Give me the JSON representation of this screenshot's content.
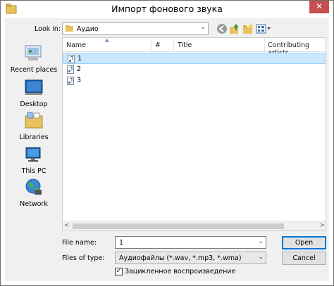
{
  "window": {
    "title": "Импорт фонового звука",
    "close_label": "✕"
  },
  "lookin": {
    "label": "Look in:",
    "value": "Аудио"
  },
  "toolbar": {
    "back": "back-icon",
    "up": "up-folder-icon",
    "new_folder": "new-folder-icon",
    "view": "view-menu-icon"
  },
  "places": [
    {
      "label": "Recent places",
      "icon": "recent-places-icon"
    },
    {
      "label": "Desktop",
      "icon": "desktop-icon"
    },
    {
      "label": "Libraries",
      "icon": "libraries-icon"
    },
    {
      "label": "This PC",
      "icon": "this-pc-icon"
    },
    {
      "label": "Network",
      "icon": "network-icon"
    }
  ],
  "columns": [
    {
      "label": "Name"
    },
    {
      "label": "#"
    },
    {
      "label": "Title"
    },
    {
      "label": "Contributing artists"
    }
  ],
  "files": [
    {
      "name": "1",
      "selected": true
    },
    {
      "name": "2",
      "selected": false
    },
    {
      "name": "3",
      "selected": false
    }
  ],
  "filename": {
    "label": "File name:",
    "value": "1"
  },
  "filetype": {
    "label": "Files of type:",
    "value": "Аудиофайлы (*.wav, *.mp3, *.wma)"
  },
  "buttons": {
    "open": "Open",
    "cancel": "Cancel"
  },
  "loop": {
    "label": "Зацикленное воспроизведение",
    "checked": true
  },
  "colors": {
    "accent": "#0078d7",
    "selection": "#cce8ff",
    "close": "#c74f4f"
  }
}
